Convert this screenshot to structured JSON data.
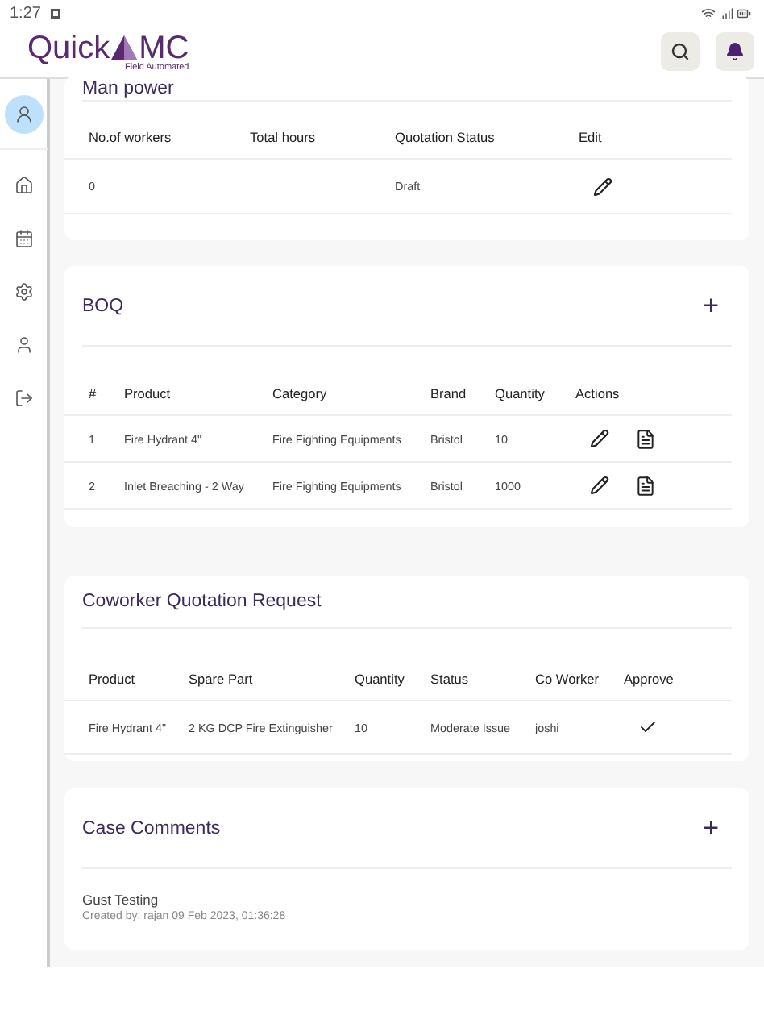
{
  "status_bar": {
    "time": "1:27"
  },
  "header": {
    "logo": {
      "first": "Quick",
      "second": "MC",
      "tagline": "Field Automated"
    }
  },
  "sidebar": {
    "items": [
      {
        "kind": "profile",
        "selected": true
      },
      {
        "kind": "home",
        "selected": false
      },
      {
        "kind": "calendar",
        "selected": false
      },
      {
        "kind": "settings",
        "selected": false
      },
      {
        "kind": "user",
        "selected": false
      },
      {
        "kind": "logout",
        "selected": false
      }
    ]
  },
  "manpower": {
    "title": "Man power",
    "columns": [
      "No.of workers",
      "Total hours",
      "Quotation Status",
      "Edit"
    ],
    "rows": [
      {
        "cells": [
          "0",
          "",
          "Draft"
        ],
        "actions": [
          {
            "kind": "edit"
          }
        ]
      }
    ]
  },
  "boq": {
    "title": "BOQ",
    "add": "+",
    "columns": [
      "#",
      "Product",
      "Category",
      "Brand",
      "Quantity",
      "Actions"
    ],
    "rows": [
      {
        "cells": [
          "1",
          "Fire Hydrant 4\"",
          "Fire Fighting Equipments",
          "Bristol",
          "10"
        ],
        "actions": [
          {
            "kind": "edit"
          },
          {
            "kind": "details"
          }
        ]
      },
      {
        "cells": [
          "2",
          "Inlet Breaching - 2 Way",
          "Fire Fighting Equipments",
          "Bristol",
          "1000"
        ],
        "actions": [
          {
            "kind": "edit"
          },
          {
            "kind": "details"
          }
        ]
      }
    ]
  },
  "coworker": {
    "title": "Coworker Quotation Request",
    "columns": [
      "Product",
      "Spare Part",
      "Quantity",
      "Status",
      "Co Worker",
      "Approve"
    ],
    "rows": [
      {
        "cells": [
          "Fire Hydrant 4\"",
          "2 KG DCP Fire Extinguisher",
          "10",
          "Moderate Issue",
          "joshi"
        ],
        "actions": [
          {
            "kind": "approve"
          }
        ]
      }
    ]
  },
  "comments": {
    "title": "Case Comments",
    "add": "+",
    "items": [
      {
        "text": "Gust Testing",
        "meta": "Created by: rajan  09 Feb 2023, 01:36:28"
      }
    ]
  }
}
